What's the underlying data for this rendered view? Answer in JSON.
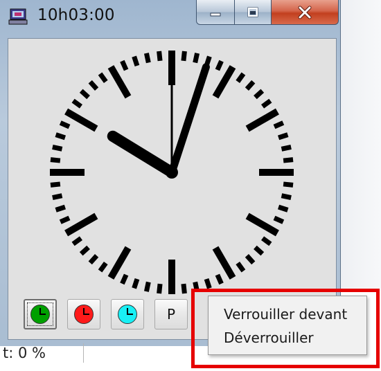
{
  "window": {
    "title": "10h03:00",
    "controls": {
      "minimize": "minimize-icon",
      "maximize": "maximize-icon",
      "close": "close-icon"
    }
  },
  "clock": {
    "time_shown": "10h03:00",
    "hours": 10,
    "minutes": 3,
    "seconds": 0,
    "face_color": "#e1e1e1",
    "mark_color": "#000000"
  },
  "toolbar": {
    "buttons": [
      {
        "icon": "clock-green-icon",
        "color": "#00a000",
        "active": true
      },
      {
        "icon": "clock-red-icon",
        "color": "#ff1a1a",
        "active": false
      },
      {
        "icon": "clock-cyan-icon",
        "color": "#19f0f5",
        "active": false
      },
      {
        "label": "P"
      }
    ]
  },
  "status_bar": {
    "text": "t: 0 %"
  },
  "context_menu": {
    "items": [
      "Verrouiller devant",
      "Déverrouiller"
    ]
  },
  "annotation": {
    "color": "#e60000"
  }
}
